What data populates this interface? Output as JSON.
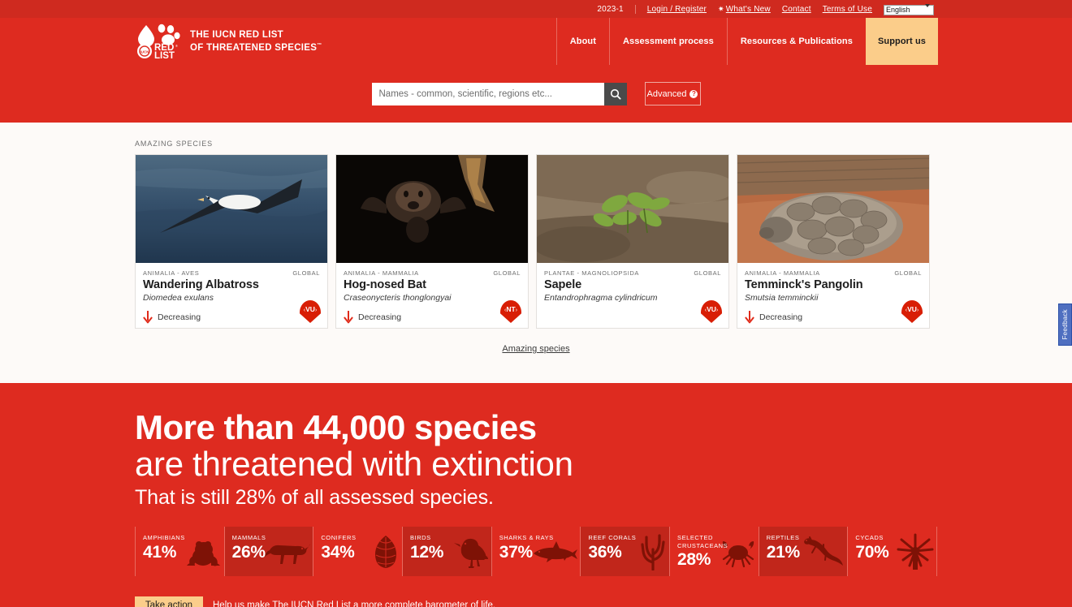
{
  "utility": {
    "version": "2023-1",
    "links": [
      {
        "label": "Login / Register",
        "icon": ""
      },
      {
        "label": "What's New",
        "icon": "star-icon"
      },
      {
        "label": "Contact",
        "icon": ""
      },
      {
        "label": "Terms of Use",
        "icon": ""
      }
    ],
    "language": "English"
  },
  "brand": {
    "line1": "THE IUCN RED LIST",
    "line2": "OF THREATENED SPECIES",
    "tm": "™",
    "logo_text_line1": "RED",
    "logo_text_line2": "LIST",
    "logo_reg": "®"
  },
  "nav": {
    "items": [
      {
        "label": "About",
        "highlight": false
      },
      {
        "label": "Assessment process",
        "highlight": false
      },
      {
        "label": "Resources & Publications",
        "highlight": false
      },
      {
        "label": "Support us",
        "highlight": true
      }
    ]
  },
  "search": {
    "placeholder": "Names - common, scientific, regions etc...",
    "value": "",
    "button_icon": "search-icon",
    "advanced_label": "Advanced",
    "advanced_help_icon": "question-icon"
  },
  "amazing": {
    "section_label": "AMAZING SPECIES",
    "more_label": "Amazing species",
    "cards": [
      {
        "taxon": "ANIMALIA - AVES",
        "scope": "GLOBAL",
        "common_name": "Wandering Albatross",
        "scientific_name": "Diomedea exulans",
        "trend": "Decreasing",
        "trend_icon": "arrow-down-icon",
        "status_code": "VU",
        "image": "albatross-photo"
      },
      {
        "taxon": "ANIMALIA - MAMMALIA",
        "scope": "GLOBAL",
        "common_name": "Hog-nosed Bat",
        "scientific_name": "Craseonycteris thonglongyai",
        "trend": "Decreasing",
        "trend_icon": "arrow-down-icon",
        "status_code": "NT",
        "image": "bat-photo"
      },
      {
        "taxon": "PLANTAE - MAGNOLIOPSIDA",
        "scope": "GLOBAL",
        "common_name": "Sapele",
        "scientific_name": "Entandrophragma cylindricum",
        "trend": "",
        "trend_icon": "",
        "status_code": "VU",
        "image": "seedling-photo"
      },
      {
        "taxon": "ANIMALIA - MAMMALIA",
        "scope": "GLOBAL",
        "common_name": "Temminck's Pangolin",
        "scientific_name": "Smutsia temminckii",
        "trend": "Decreasing",
        "trend_icon": "arrow-down-icon",
        "status_code": "VU",
        "image": "pangolin-photo"
      }
    ]
  },
  "hero": {
    "headline1": "More than 44,000 species",
    "headline2": "are threatened with extinction",
    "subline": "That is still 28% of all assessed species.",
    "stats": [
      {
        "label": "AMPHIBIANS",
        "value": "41%",
        "icon": "frog-icon",
        "dark": false
      },
      {
        "label": "MAMMALS",
        "value": "26%",
        "icon": "bigcat-icon",
        "dark": true
      },
      {
        "label": "CONIFERS",
        "value": "34%",
        "icon": "pinecone-icon",
        "dark": false
      },
      {
        "label": "BIRDS",
        "value": "12%",
        "icon": "bird-icon",
        "dark": true
      },
      {
        "label": "SHARKS & RAYS",
        "value": "37%",
        "icon": "shark-icon",
        "dark": false
      },
      {
        "label": "REEF CORALS",
        "value": "36%",
        "icon": "coral-icon",
        "dark": true
      },
      {
        "label": "SELECTED CRUSTACEANS",
        "value": "28%",
        "icon": "crab-icon",
        "dark": false
      },
      {
        "label": "REPTILES",
        "value": "21%",
        "icon": "lizard-icon",
        "dark": true
      },
      {
        "label": "CYCADS",
        "value": "70%",
        "icon": "cycad-icon",
        "dark": false
      }
    ],
    "cta_button": "Take action",
    "cta_text": "Help us make The IUCN Red List a more complete barometer of life."
  },
  "feedback": {
    "label": "Feedback"
  },
  "colors": {
    "header_red": "#de2b20",
    "utility_red": "#cf2a1f",
    "accent_tan": "#fbcd8a",
    "badge_red": "#d81e05",
    "stat_dark_red": "#c1261b",
    "page_bg": "#fdfaf8",
    "feedback_blue": "#4f6fc0"
  }
}
